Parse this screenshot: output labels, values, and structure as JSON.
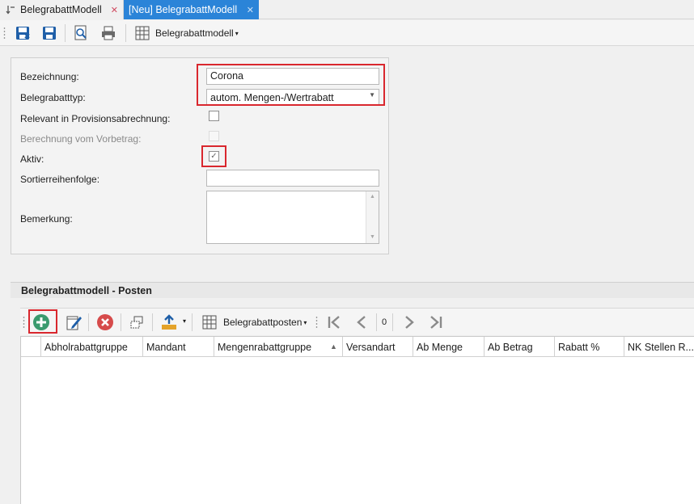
{
  "tabs": [
    {
      "label": "BelegrabattModell",
      "active": false
    },
    {
      "label": "[Neu] BelegrabattModell",
      "active": true
    }
  ],
  "toolbar": {
    "grid_menu_label": "Belegrabattmodell"
  },
  "form": {
    "bezeichnung_label": "Bezeichnung:",
    "bezeichnung_value": "Corona",
    "typ_label": "Belegrabatttyp:",
    "typ_value": "autom. Mengen-/Wertrabatt",
    "provision_label": "Relevant in Provisionsabrechnung:",
    "provision_checked": false,
    "vorbetrag_label": "Berechnung vom Vorbetrag:",
    "vorbetrag_checked": false,
    "aktiv_label": "Aktiv:",
    "aktiv_checked": true,
    "sortier_label": "Sortierreihenfolge:",
    "sortier_value": "",
    "bemerkung_label": "Bemerkung:",
    "bemerkung_value": ""
  },
  "posten": {
    "title": "Belegrabattmodell - Posten",
    "grid_menu_label": "Belegrabattposten",
    "page_number": "0",
    "columns": [
      "Abholrabattgruppe",
      "Mandant",
      "Mengenrabattgruppe",
      "Versandart",
      "Ab Menge",
      "Ab Betrag",
      "Rabatt %",
      "NK Stellen R..."
    ],
    "sorted_column": "Mengenrabattgruppe",
    "rows": []
  },
  "colors": {
    "active_tab": "#2b84d8",
    "highlight": "#d9272e",
    "add_green": "#3a9a6e",
    "delete_red": "#d64b4b"
  }
}
